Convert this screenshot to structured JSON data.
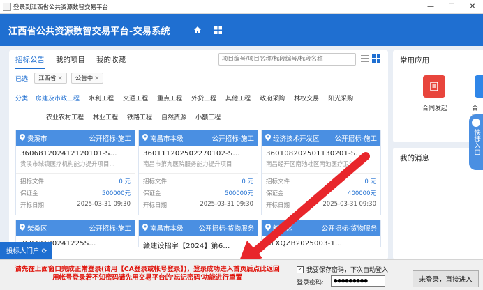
{
  "window": {
    "title": "登录到江西省公共资源数智交易平台",
    "minimize": "—",
    "maximize": "☐",
    "close": "✕"
  },
  "header": {
    "system_title": "江西省公共资源数智交易平台-交易系统"
  },
  "tabs": [
    "招标公告",
    "我的项目",
    "我的收藏"
  ],
  "search": {
    "placeholder": "项目编号/项目名称/标段编号/标段名称"
  },
  "filters": {
    "selected_label": "已选:",
    "chips": [
      "江西省",
      "公告中"
    ],
    "category_label": "分类:",
    "categories_row1": [
      "房建及市政工程",
      "水利工程",
      "交通工程",
      "重点工程",
      "外贷工程",
      "其他工程",
      "政府采购",
      "林权交易",
      "阳光采购"
    ],
    "categories_row2": [
      "农业农村工程",
      "林业工程",
      "铁路工程",
      "自然资源",
      "小额工程"
    ]
  },
  "cards": [
    {
      "region": "贵溪市",
      "type": "公开招标-施工",
      "code": "360681202412120101-S...",
      "name": "贵溪市城镇医疗机构能力提升项目...",
      "fee_label": "招标文件",
      "fee_value": "0 元",
      "deposit_label": "保证金",
      "deposit_value": "500000元",
      "date_label": "开标日期",
      "date_value": "2025-03-31 09:30"
    },
    {
      "region": "南昌市本级",
      "type": "公开招标-施工",
      "code": "360111202502270102-S...",
      "name": "南昌市第九医院服务能力提升项目",
      "fee_label": "招标文件",
      "fee_value": "0 元",
      "deposit_label": "保证金",
      "deposit_value": "500000元",
      "date_label": "开标日期",
      "date_value": "2025-03-31 09:30"
    },
    {
      "region": "经济技术开发区",
      "type": "公开招标-施工",
      "code": "360108202501130201-S...",
      "name": "南昌经开区南池社区南池医疗卫生...",
      "fee_label": "招标文件",
      "fee_value": "0 元",
      "deposit_label": "保证金",
      "deposit_value": "400000元",
      "date_label": "开标日期",
      "date_value": "2025-03-31 09:30"
    }
  ],
  "cards_row2": [
    {
      "region": "柴桑区",
      "type": "公开招标-施工",
      "code": "36042120241225S..."
    },
    {
      "region": "南昌市本级",
      "type": "公开招标-货物服务",
      "code": "赣建设招字【2024】第6..."
    },
    {
      "region": "新建区",
      "type": "公开招标-货物服务",
      "code": "HLXQZB2025003-1..."
    }
  ],
  "common_apps": {
    "title": "常用应用",
    "apps": [
      "合同发起",
      "合同"
    ]
  },
  "messages": {
    "title": "我的消息"
  },
  "quick_entry": {
    "label": "快捷入口"
  },
  "bidder_portal": {
    "label": "投标人门户 ⟳"
  },
  "login": {
    "notice_line1": "请先在上面窗口完成正常登录(请用【CA登录或帐号登录】)，登录成功进入首页后点此返回",
    "notice_line2": "用帐号登录若不知密码请先用交易平台的'忘记密码'功能进行重置",
    "remember_label": "我要保存密码，下次自动登入",
    "remember_checked": "✓",
    "password_label": "登录密码:",
    "password_value": "●●●●●●●●●",
    "enter_button": "未登录，直接进入"
  },
  "colors": {
    "primary": "#1f6fd1",
    "card_header": "#4a8fe2",
    "notice_red": "#e0140c",
    "app_red": "#e8453c"
  }
}
